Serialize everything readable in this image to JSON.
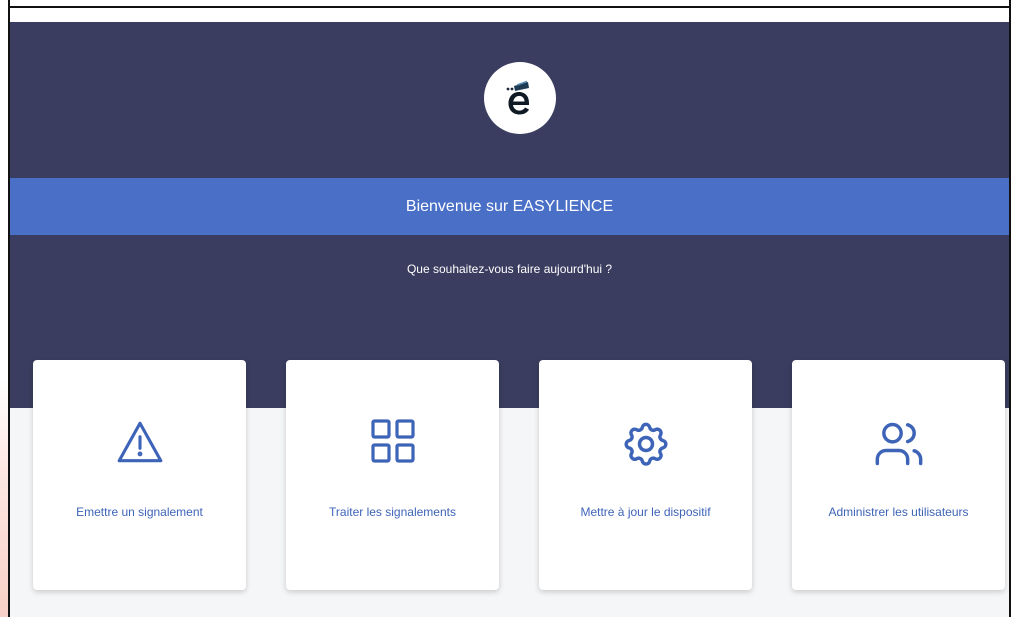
{
  "header": {
    "logo_name": "easylience-logo",
    "welcome_text": "Bienvenue sur EASYLIENCE",
    "subtitle": "Que souhaitez-vous faire aujourd'hui ?"
  },
  "actions": [
    {
      "label": "Emettre un signalement",
      "icon": "warning-triangle-icon"
    },
    {
      "label": "Traiter les signalements",
      "icon": "grid-icon"
    },
    {
      "label": "Mettre à jour le dispositif",
      "icon": "gear-icon"
    },
    {
      "label": "Administrer les utilisateurs",
      "icon": "users-icon"
    }
  ],
  "colors": {
    "hero_background": "#3b3d60",
    "band_background": "#4a6fc7",
    "accent": "#3e64b8",
    "page_background": "#f5f6f8"
  }
}
